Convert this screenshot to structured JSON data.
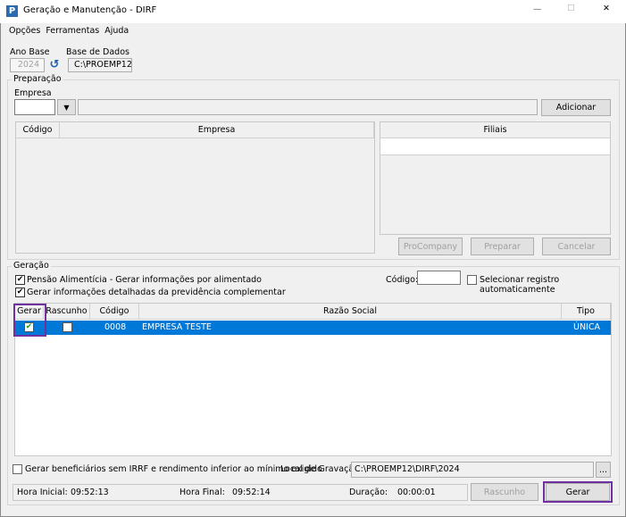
{
  "window": {
    "title": "Geração e Manutenção - DIRF",
    "minimize": "—",
    "maximize": "☐",
    "close": "✕"
  },
  "menu": [
    "Opções",
    "Ferramentas",
    "Ajuda"
  ],
  "ano_base": {
    "label": "Ano Base",
    "value": "2024"
  },
  "base_dados": {
    "label": "Base de Dados",
    "value": "C:\\PROEMP12"
  },
  "preparacao": {
    "title": "Preparação",
    "empresa_label": "Empresa",
    "adicionar": "Adicionar",
    "table_headers": [
      "Código",
      "Empresa"
    ],
    "filiais_header": "Filiais",
    "buttons": {
      "procompany": "ProCompany",
      "preparar": "Preparar",
      "cancelar": "Cancelar"
    }
  },
  "geracao": {
    "title": "Geração",
    "pensao": "Pensão Alimentícia - Gerar informações por alimentado",
    "previdencia": "Gerar informações detalhadas da previdência complementar",
    "codigo_label": "Código:",
    "codigo_value": "",
    "auto_select": "Selecionar registro automaticamente",
    "grid_headers": [
      "Gerar",
      "Rascunho",
      "Código",
      "Razão Social",
      "Tipo"
    ],
    "rows": [
      {
        "gerar": true,
        "rascunho": false,
        "codigo": "0008",
        "razao": "EMPRESA TESTE",
        "tipo": "ÚNICA"
      }
    ],
    "beneficiarios": "Gerar beneficiários sem IRRF e rendimento inferior ao mínimo exigido",
    "local_label": "Local de Gravação",
    "local_value": "C:\\PROEMP12\\DIRF\\2024",
    "browse": "..."
  },
  "status": {
    "hora_inicial_label": "Hora Inicial:",
    "hora_inicial": "09:52:13",
    "hora_final_label": "Hora Final:",
    "hora_final": "09:52:14",
    "duracao_label": "Duração:",
    "duracao": "00:00:01"
  },
  "buttons": {
    "rascunho": "Rascunho",
    "gerar": "Gerar"
  },
  "colors": {
    "selection": "#0078d7",
    "highlight": "#7030a0"
  }
}
